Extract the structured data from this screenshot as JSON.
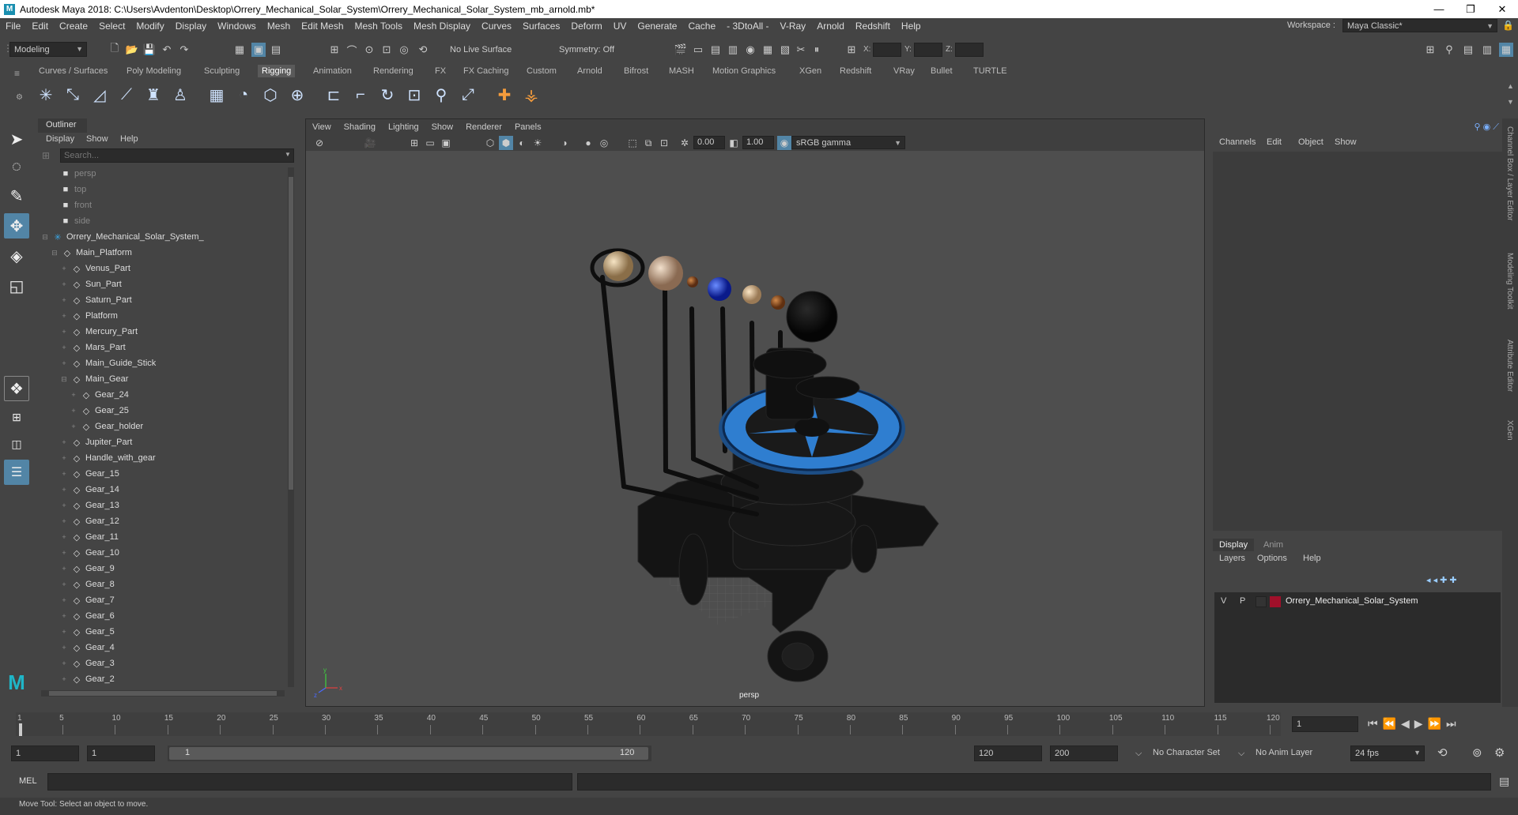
{
  "title_bar": {
    "title": "Autodesk Maya 2018: C:\\Users\\Avdenton\\Desktop\\Orrery_Mechanical_Solar_System\\Orrery_Mechanical_Solar_System_mb_arnold.mb*",
    "minimize": "—",
    "maximize": "❐",
    "close": "✕"
  },
  "menu": [
    "File",
    "Edit",
    "Create",
    "Select",
    "Modify",
    "Display",
    "Windows",
    "Mesh",
    "Edit Mesh",
    "Mesh Tools",
    "Mesh Display",
    "Curves",
    "Surfaces",
    "Deform",
    "UV",
    "Generate",
    "Cache",
    "- 3DtoAll -",
    "V-Ray",
    "Arnold",
    "Redshift",
    "Help"
  ],
  "workspace": {
    "label": "Workspace :",
    "value": "Maya Classic*"
  },
  "status_line": {
    "menuset": "Modeling",
    "live_surface": "No Live Surface",
    "symmetry": "Symmetry: Off",
    "x_label": "X:",
    "y_label": "Y:",
    "z_label": "Z:"
  },
  "shelf_tabs": [
    "Curves / Surfaces",
    "Poly Modeling",
    "Sculpting",
    "Rigging",
    "Animation",
    "Rendering",
    "FX",
    "FX Caching",
    "Custom",
    "Arnold",
    "Bifrost",
    "MASH",
    "Motion Graphics",
    "XGen",
    "Redshift",
    "VRay",
    "Bullet",
    "TURTLE"
  ],
  "active_shelf_tab": "Rigging",
  "outliner": {
    "tab": "Outliner",
    "menus": [
      "Display",
      "Show",
      "Help"
    ],
    "search_placeholder": "Search...",
    "rows": [
      {
        "label": "persp",
        "indent": 0,
        "type": "camera",
        "dim": true
      },
      {
        "label": "top",
        "indent": 0,
        "type": "camera",
        "dim": true
      },
      {
        "label": "front",
        "indent": 0,
        "type": "camera",
        "dim": true
      },
      {
        "label": "side",
        "indent": 0,
        "type": "camera",
        "dim": true
      },
      {
        "label": "Orrery_Mechanical_Solar_System_",
        "indent": 0,
        "type": "group-root",
        "expand": "−"
      },
      {
        "label": "Main_Platform",
        "indent": 1,
        "type": "mesh",
        "expand": "−"
      },
      {
        "label": "Venus_Part",
        "indent": 2,
        "type": "mesh",
        "expand": "+"
      },
      {
        "label": "Sun_Part",
        "indent": 2,
        "type": "mesh",
        "expand": "+"
      },
      {
        "label": "Saturn_Part",
        "indent": 2,
        "type": "mesh",
        "expand": "+"
      },
      {
        "label": "Platform",
        "indent": 2,
        "type": "mesh",
        "expand": "+"
      },
      {
        "label": "Mercury_Part",
        "indent": 2,
        "type": "mesh",
        "expand": "+"
      },
      {
        "label": "Mars_Part",
        "indent": 2,
        "type": "mesh",
        "expand": "+"
      },
      {
        "label": "Main_Guide_Stick",
        "indent": 2,
        "type": "mesh",
        "expand": "+"
      },
      {
        "label": "Main_Gear",
        "indent": 2,
        "type": "mesh",
        "expand": "−"
      },
      {
        "label": "Gear_24",
        "indent": 3,
        "type": "mesh",
        "expand": "+"
      },
      {
        "label": "Gear_25",
        "indent": 3,
        "type": "mesh",
        "expand": "+"
      },
      {
        "label": "Gear_holder",
        "indent": 3,
        "type": "mesh",
        "expand": "+"
      },
      {
        "label": "Jupiter_Part",
        "indent": 2,
        "type": "mesh",
        "expand": "+"
      },
      {
        "label": "Handle_with_gear",
        "indent": 2,
        "type": "mesh",
        "expand": "+"
      },
      {
        "label": "Gear_15",
        "indent": 2,
        "type": "mesh",
        "expand": "+"
      },
      {
        "label": "Gear_14",
        "indent": 2,
        "type": "mesh",
        "expand": "+"
      },
      {
        "label": "Gear_13",
        "indent": 2,
        "type": "mesh",
        "expand": "+"
      },
      {
        "label": "Gear_12",
        "indent": 2,
        "type": "mesh",
        "expand": "+"
      },
      {
        "label": "Gear_11",
        "indent": 2,
        "type": "mesh",
        "expand": "+"
      },
      {
        "label": "Gear_10",
        "indent": 2,
        "type": "mesh",
        "expand": "+"
      },
      {
        "label": "Gear_9",
        "indent": 2,
        "type": "mesh",
        "expand": "+"
      },
      {
        "label": "Gear_8",
        "indent": 2,
        "type": "mesh",
        "expand": "+"
      },
      {
        "label": "Gear_7",
        "indent": 2,
        "type": "mesh",
        "expand": "+"
      },
      {
        "label": "Gear_6",
        "indent": 2,
        "type": "mesh",
        "expand": "+"
      },
      {
        "label": "Gear_5",
        "indent": 2,
        "type": "mesh",
        "expand": "+"
      },
      {
        "label": "Gear_4",
        "indent": 2,
        "type": "mesh",
        "expand": "+"
      },
      {
        "label": "Gear_3",
        "indent": 2,
        "type": "mesh",
        "expand": "+"
      },
      {
        "label": "Gear_2",
        "indent": 2,
        "type": "mesh",
        "expand": "+"
      }
    ]
  },
  "viewport": {
    "menus": [
      "View",
      "Shading",
      "Lighting",
      "Show",
      "Renderer",
      "Panels"
    ],
    "field_a": "0.00",
    "field_b": "1.00",
    "color_space": "sRGB gamma",
    "camera_label": "persp"
  },
  "channel_box": {
    "menus": [
      "Channels",
      "Edit",
      "Object",
      "Show"
    ],
    "layer_tabs": [
      "Display",
      "Anim"
    ],
    "layer_menus": [
      "Layers",
      "Options",
      "Help"
    ],
    "layer": {
      "v": "V",
      "p": "P",
      "name": "Orrery_Mechanical_Solar_System",
      "color": "#a0102a"
    }
  },
  "side_tabs": [
    "Channel Box / Layer Editor",
    "Modeling Toolkit",
    "Attribute Editor",
    "XGen"
  ],
  "time_slider": {
    "ticks": [
      "1",
      "5",
      "10",
      "15",
      "20",
      "25",
      "30",
      "35",
      "40",
      "45",
      "50",
      "55",
      "60",
      "65",
      "70",
      "75",
      "80",
      "85",
      "90",
      "95",
      "100",
      "105",
      "110",
      "115",
      "120"
    ],
    "current_frame": "1"
  },
  "range_slider": {
    "start": "1",
    "playback_start": "1",
    "range_start_label": "1",
    "range_end_label": "120",
    "playback_end": "120",
    "end": "200",
    "character_set": "No Character Set",
    "anim_layer": "No Anim Layer",
    "fps": "24 fps"
  },
  "command_line": {
    "label": "MEL"
  },
  "help_line": "Move Tool: Select an object to move.",
  "colors": {
    "bg": "#444444",
    "field": "#2b2b2b",
    "accent_select": "#5285a6",
    "viewport_bg": "#4e4e4e"
  }
}
